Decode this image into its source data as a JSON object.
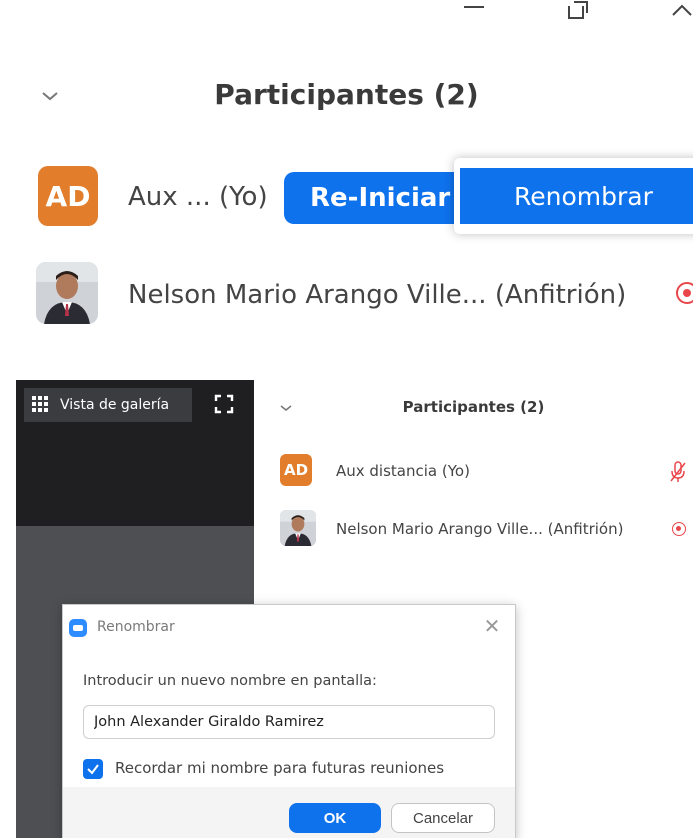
{
  "top_panel": {
    "window_controls": [
      "minimize-icon",
      "restore-icon",
      "chevron-up-icon"
    ],
    "title": "Participantes (2)",
    "self": {
      "initials": "AD",
      "name": "Aux ... (Yo)",
      "button_label": "Re-Iniciar ..."
    },
    "menu": {
      "item_label": "Renombrar"
    },
    "host": {
      "name": "Nelson Mario Arango Ville... (Anfitrión)"
    }
  },
  "bottom_panel": {
    "gallery_button_label": "Vista de galería",
    "participants_title": "Participantes (2)",
    "self": {
      "initials": "AD",
      "name": "Aux distancia (Yo)"
    },
    "host": {
      "name": "Nelson Mario Arango Ville... (Anfitrión)"
    }
  },
  "dialog": {
    "title": "Renombrar",
    "prompt": "Introducir un nuevo nombre en pantalla:",
    "input_value": "John Alexander Giraldo Ramirez",
    "remember_label": "Recordar mi nombre para futuras reuniones",
    "remember_checked": true,
    "ok_label": "OK",
    "cancel_label": "Cancelar"
  },
  "colors": {
    "accent": "#0e72ed",
    "avatar_orange": "#e27d2b",
    "recording_red": "#e8464a",
    "dark_video": "#1f1f22"
  }
}
